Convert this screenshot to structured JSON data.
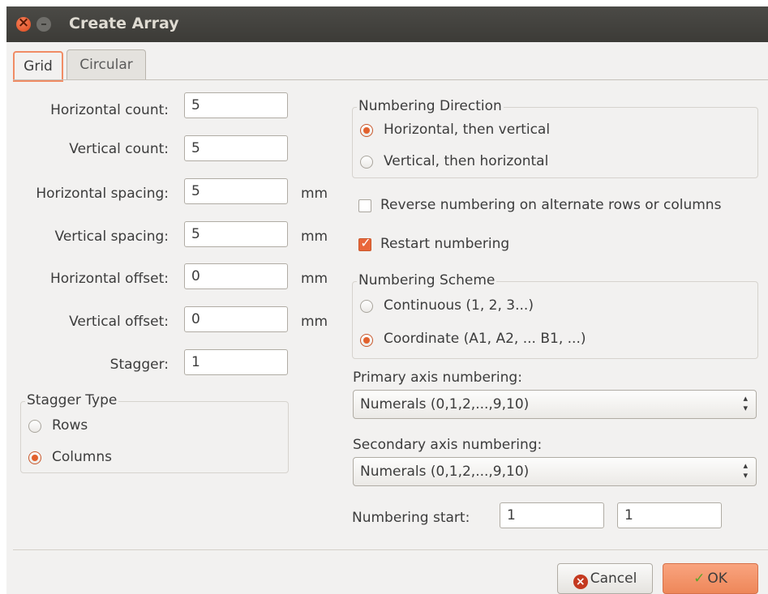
{
  "window": {
    "title": "Create Array"
  },
  "tabs": [
    {
      "label": "Grid",
      "active": true
    },
    {
      "label": "Circular",
      "active": false
    }
  ],
  "grid": {
    "fields": [
      {
        "label": "Horizontal count:",
        "value": "5",
        "unit": ""
      },
      {
        "label": "Vertical count:",
        "value": "5",
        "unit": ""
      },
      {
        "label": "Horizontal spacing:",
        "value": "5",
        "unit": "mm"
      },
      {
        "label": "Vertical spacing:",
        "value": "5",
        "unit": "mm"
      },
      {
        "label": "Horizontal offset:",
        "value": "0",
        "unit": "mm"
      },
      {
        "label": "Vertical offset:",
        "value": "0",
        "unit": "mm"
      },
      {
        "label": "Stagger:",
        "value": "1",
        "unit": ""
      }
    ],
    "stagger_type": {
      "title": "Stagger Type",
      "options": [
        {
          "label": "Rows",
          "selected": false
        },
        {
          "label": "Columns",
          "selected": true
        }
      ]
    },
    "numbering_direction": {
      "title": "Numbering Direction",
      "options": [
        {
          "label": "Horizontal, then vertical",
          "selected": true
        },
        {
          "label": "Vertical, then horizontal",
          "selected": false
        }
      ]
    },
    "reverse_numbering": {
      "label": "Reverse numbering on alternate rows or columns",
      "checked": false
    },
    "restart_numbering": {
      "label": "Restart numbering",
      "checked": true
    },
    "numbering_scheme": {
      "title": "Numbering Scheme",
      "options": [
        {
          "label": "Continuous (1, 2, 3...)",
          "selected": false
        },
        {
          "label": "Coordinate (A1, A2, ... B1, ...)",
          "selected": true
        }
      ]
    },
    "primary_axis": {
      "label": "Primary axis numbering:",
      "value": "Numerals (0,1,2,...,9,10)"
    },
    "secondary_axis": {
      "label": "Secondary axis numbering:",
      "value": "Numerals (0,1,2,...,9,10)"
    },
    "numbering_start": {
      "label": "Numbering start:",
      "value1": "1",
      "value2": "1"
    }
  },
  "buttons": {
    "cancel": "Cancel",
    "ok": "OK"
  },
  "colors": {
    "accent": "#e9663a",
    "titlebar": "#3c3b37",
    "background": "#f2f1f0"
  }
}
